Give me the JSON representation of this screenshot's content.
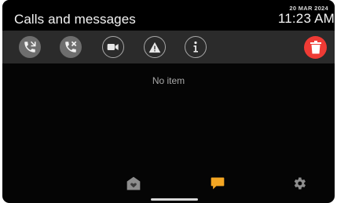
{
  "header": {
    "title": "Calls and messages",
    "date": "20 MAR 2024",
    "time": "11:23 AM"
  },
  "toolbar": {
    "filters": [
      {
        "icon": "missed-call-icon"
      },
      {
        "icon": "rejected-call-icon"
      },
      {
        "icon": "video-icon"
      },
      {
        "icon": "warning-icon"
      },
      {
        "icon": "info-icon"
      }
    ],
    "delete_icon": "trash-icon",
    "delete_color": "#ef3b35"
  },
  "content": {
    "empty_text": "No item"
  },
  "bottom_nav": {
    "items": [
      {
        "icon": "home-icon",
        "active": false
      },
      {
        "icon": "messages-icon",
        "active": true,
        "color": "#f4a623"
      },
      {
        "icon": "settings-icon",
        "active": false
      }
    ]
  }
}
